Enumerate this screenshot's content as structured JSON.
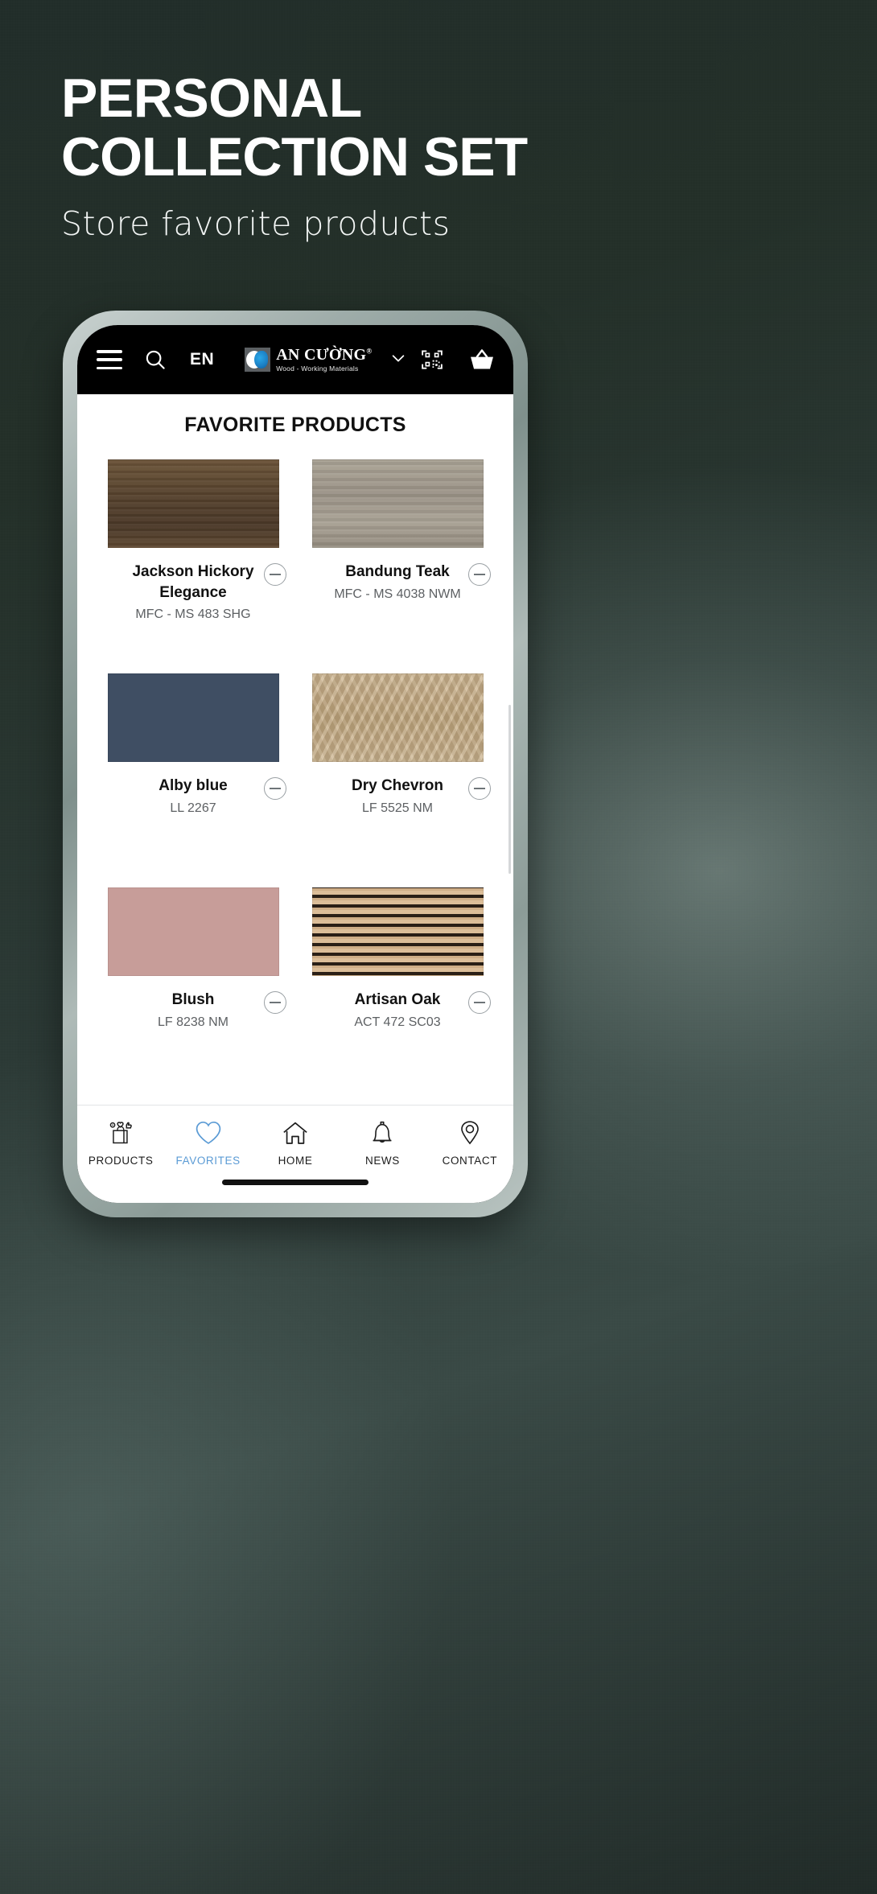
{
  "hero": {
    "title_line1": "PERSONAL",
    "title_line2": "COLLECTION SET",
    "subtitle": "Store favorite products"
  },
  "appbar": {
    "menu_icon": "hamburger-icon",
    "search_icon": "search-icon",
    "language": "EN",
    "brand_name": "AN CƯỜNG",
    "brand_reg": "®",
    "brand_tagline": "Wood - Working Materials",
    "dropdown_icon": "chevron-down-icon",
    "qr_icon": "qr-scan-icon",
    "cart_icon": "shopping-basket-icon"
  },
  "main": {
    "page_title": "FAVORITE PRODUCTS",
    "products": [
      {
        "name": "Jackson Hickory Elegance",
        "code": "MFC - MS 483 SHG",
        "color": "#5a4531",
        "swatch_type": "wood-dark-horizontal",
        "remove_label": "remove"
      },
      {
        "name": "Bandung Teak",
        "code": "MFC - MS 4038 NWM",
        "color": "#a09a8c",
        "swatch_type": "wood-grey-horizontal",
        "remove_label": "remove"
      },
      {
        "name": "Alby blue",
        "code": "LL 2267",
        "color": "#3f4e63",
        "swatch_type": "solid",
        "remove_label": "remove"
      },
      {
        "name": "Dry Chevron",
        "code": "LF 5525 NM",
        "color": "#c6ae88",
        "swatch_type": "chevron",
        "remove_label": "remove"
      },
      {
        "name": "Blush",
        "code": "LF 8238 NM",
        "color": "#c79d99",
        "swatch_type": "solid",
        "remove_label": "remove"
      },
      {
        "name": "Artisan Oak",
        "code": "ACT 472 SC03",
        "color": "#d7b894",
        "swatch_type": "slats",
        "remove_label": "remove"
      }
    ]
  },
  "bottom_nav": {
    "active_index": 1,
    "accent_color": "#5b9bd5",
    "items": [
      {
        "label": "PRODUCTS",
        "icon": "products-bag-icon"
      },
      {
        "label": "FAVORITES",
        "icon": "heart-icon"
      },
      {
        "label": "HOME",
        "icon": "home-icon"
      },
      {
        "label": "NEWS",
        "icon": "bell-icon"
      },
      {
        "label": "CONTACT",
        "icon": "map-pin-icon"
      }
    ]
  }
}
